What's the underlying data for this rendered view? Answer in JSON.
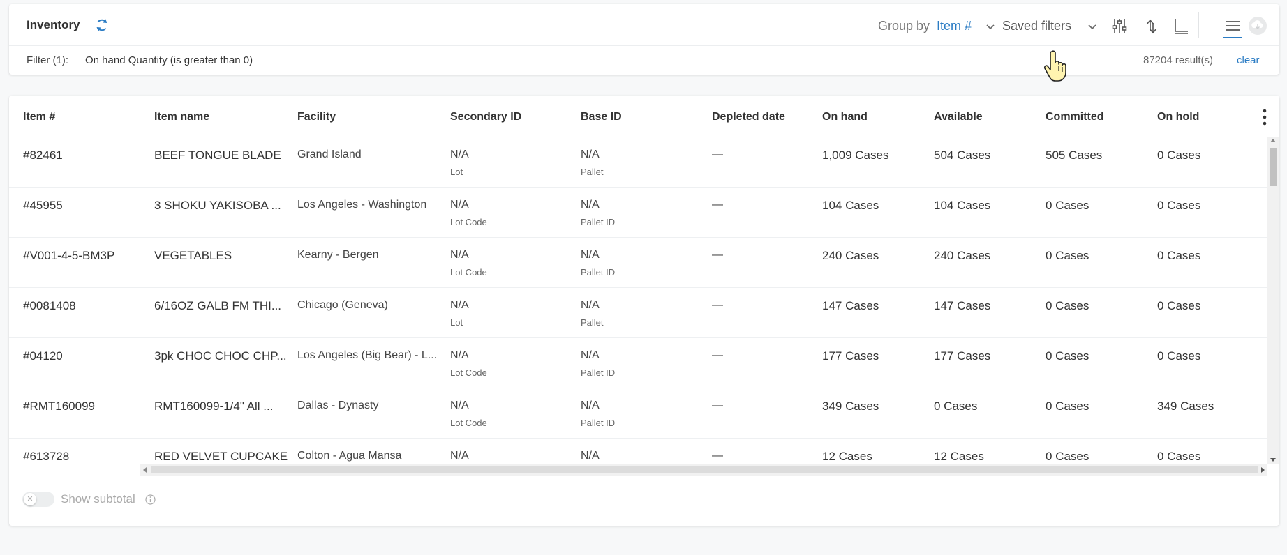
{
  "header": {
    "title": "Inventory",
    "group_by_label": "Group by",
    "group_by_value": "Item #",
    "saved_filters_label": "Saved filters",
    "filter_label": "Filter (1):",
    "filter_text": "On hand Quantity (is greater than 0)",
    "results": "87204 result(s)",
    "clear_label": "clear",
    "icons": [
      "refresh-icon",
      "chevron-down-icon",
      "column-settings-icon",
      "sort-icon",
      "chart-axis-icon",
      "list-view-icon",
      "cloud-download-icon"
    ]
  },
  "table": {
    "columns": [
      "Item #",
      "Item name",
      "Facility",
      "Secondary ID",
      "Base ID",
      "Depleted date",
      "On hand",
      "Available",
      "Committed",
      "On hold"
    ],
    "rows": [
      {
        "item": "#82461",
        "name": "BEEF TONGUE BLADE",
        "facility": "Grand Island",
        "secondary": "N/A",
        "secondary_sub": "Lot",
        "base": "N/A",
        "base_sub": "Pallet",
        "depleted": "—",
        "on_hand": "1,009 Cases",
        "available": "504 Cases",
        "committed": "505 Cases",
        "on_hold": "0 Cases"
      },
      {
        "item": "#45955",
        "name": "3 SHOKU YAKISOBA ...",
        "facility": "Los Angeles - Washington",
        "secondary": "N/A",
        "secondary_sub": "Lot Code",
        "base": "N/A",
        "base_sub": "Pallet ID",
        "depleted": "—",
        "on_hand": "104 Cases",
        "available": "104 Cases",
        "committed": "0 Cases",
        "on_hold": "0 Cases"
      },
      {
        "item": "#V001-4-5-BM3P",
        "name": "VEGETABLES",
        "facility": "Kearny - Bergen",
        "secondary": "N/A",
        "secondary_sub": "Lot Code",
        "base": "N/A",
        "base_sub": "Pallet ID",
        "depleted": "—",
        "on_hand": "240 Cases",
        "available": "240 Cases",
        "committed": "0 Cases",
        "on_hold": "0 Cases"
      },
      {
        "item": "#0081408",
        "name": "6/16OZ GALB FM THI...",
        "facility": "Chicago (Geneva)",
        "secondary": "N/A",
        "secondary_sub": "Lot",
        "base": "N/A",
        "base_sub": "Pallet",
        "depleted": "—",
        "on_hand": "147 Cases",
        "available": "147 Cases",
        "committed": "0 Cases",
        "on_hold": "0 Cases"
      },
      {
        "item": "#04120",
        "name": "3pk CHOC CHOC CHP...",
        "facility": "Los Angeles (Big Bear) - L...",
        "secondary": "N/A",
        "secondary_sub": "Lot Code",
        "base": "N/A",
        "base_sub": "Pallet ID",
        "depleted": "—",
        "on_hand": "177 Cases",
        "available": "177 Cases",
        "committed": "0 Cases",
        "on_hold": "0 Cases"
      },
      {
        "item": "#RMT160099",
        "name": "RMT160099-1/4\" All ...",
        "facility": "Dallas - Dynasty",
        "secondary": "N/A",
        "secondary_sub": "Lot Code",
        "base": "N/A",
        "base_sub": "Pallet ID",
        "depleted": "—",
        "on_hand": "349 Cases",
        "available": "0 Cases",
        "committed": "0 Cases",
        "on_hold": "349 Cases"
      },
      {
        "item": "#613728",
        "name": "RED VELVET CUPCAKE",
        "facility": "Colton - Agua Mansa",
        "secondary": "N/A",
        "secondary_sub": "",
        "base": "N/A",
        "base_sub": "",
        "depleted": "—",
        "on_hand": "12 Cases",
        "available": "12 Cases",
        "committed": "0 Cases",
        "on_hold": "0 Cases"
      }
    ]
  },
  "footer": {
    "show_subtotal_label": "Show subtotal",
    "show_subtotal_on": false
  },
  "colors": {
    "accent": "#2b7cc4",
    "text": "#333333",
    "muted": "#777777"
  }
}
